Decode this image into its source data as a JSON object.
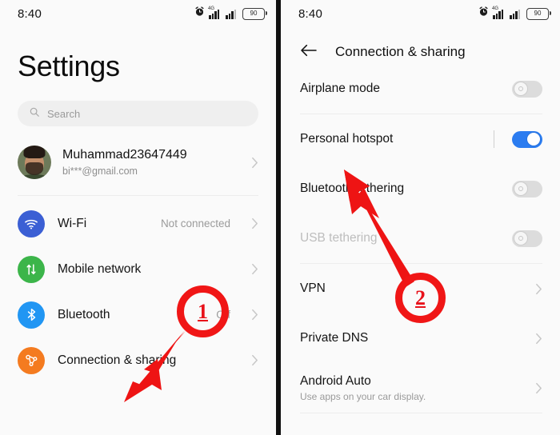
{
  "left_screen": {
    "statusbar": {
      "time": "8:40",
      "network_label": "4G",
      "battery_level": "90",
      "icons": [
        "alarm-icon",
        "signal-4g-icon",
        "signal-icon",
        "battery-icon"
      ]
    },
    "page_title": "Settings",
    "search": {
      "placeholder": "Search",
      "icon": "search-icon"
    },
    "account": {
      "name": "Muhammad23647449",
      "email": "bi***@gmail.com",
      "avatar": "user-avatar",
      "chevron": "chevron-right-icon"
    },
    "items": [
      {
        "label": "Wi-Fi",
        "value": "Not connected",
        "icon": "wifi-icon",
        "icon_color": "#3b5fd4"
      },
      {
        "label": "Mobile network",
        "value": "",
        "icon": "mobile-network-icon",
        "icon_color": "#3cb54a"
      },
      {
        "label": "Bluetooth",
        "value": "Off",
        "icon": "bluetooth-icon",
        "icon_color": "#2196f3"
      },
      {
        "label": "Connection & sharing",
        "value": "",
        "icon": "connection-sharing-icon",
        "icon_color": "#f47b20"
      }
    ]
  },
  "right_screen": {
    "statusbar": {
      "time": "8:40",
      "network_label": "4G",
      "battery_level": "90",
      "icons": [
        "alarm-icon",
        "signal-4g-icon",
        "signal-icon",
        "battery-icon"
      ]
    },
    "header": {
      "back_icon": "back-arrow-icon",
      "title": "Connection & sharing"
    },
    "rows": [
      {
        "label": "Airplane mode",
        "type": "toggle",
        "state": "off",
        "disabled": false,
        "divider_after": true
      },
      {
        "label": "Personal hotspot",
        "type": "toggle",
        "state": "on",
        "disabled": false,
        "has_vertical_rule": true,
        "divider_after": false
      },
      {
        "label": "Bluetooth tethering",
        "type": "toggle",
        "state": "off",
        "disabled": false,
        "divider_after": false
      },
      {
        "label": "USB tethering",
        "type": "toggle",
        "state": "off",
        "disabled": true,
        "divider_after": true
      },
      {
        "label": "VPN",
        "type": "chevron",
        "divider_after": false
      },
      {
        "label": "Private DNS",
        "type": "chevron",
        "divider_after": false
      },
      {
        "label": "Android Auto",
        "sublabel": "Use apps on your car display.",
        "type": "chevron",
        "divider_after": true
      }
    ]
  },
  "annotations": {
    "color": "#ee1414",
    "markers": [
      {
        "number": "1",
        "target": "Connection & sharing"
      },
      {
        "number": "2",
        "target": "Personal hotspot"
      }
    ]
  }
}
